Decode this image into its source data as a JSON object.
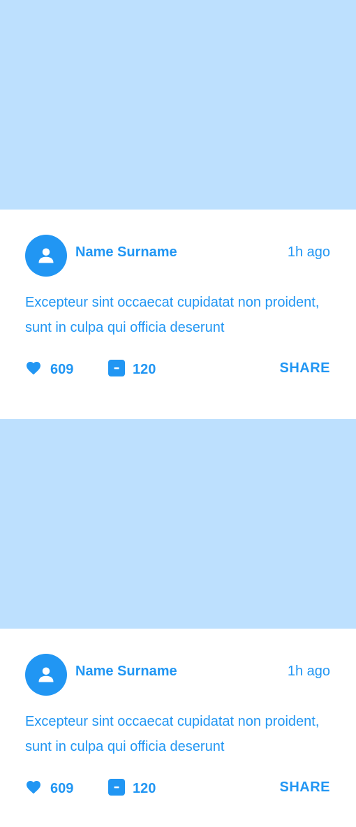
{
  "theme": {
    "accent": "#2196f3",
    "image_placeholder": "#bde0fe",
    "background": "#ffffff"
  },
  "posts": [
    {
      "author": "Name Surname",
      "time": "1h ago",
      "text": "Excepteur sint occaecat cupidatat non proident, sunt in culpa qui officia deserunt",
      "likes": "609",
      "comments": "120",
      "share_label": "SHARE",
      "icons": {
        "avatar": "person-icon",
        "likes": "heart-icon",
        "comments": "comment-icon"
      }
    },
    {
      "author": "Name Surname",
      "time": "1h ago",
      "text": "Excepteur sint occaecat cupidatat non proident, sunt in culpa qui officia deserunt",
      "likes": "609",
      "comments": "120",
      "share_label": "SHARE",
      "icons": {
        "avatar": "person-icon",
        "likes": "heart-icon",
        "comments": "comment-icon"
      }
    }
  ]
}
